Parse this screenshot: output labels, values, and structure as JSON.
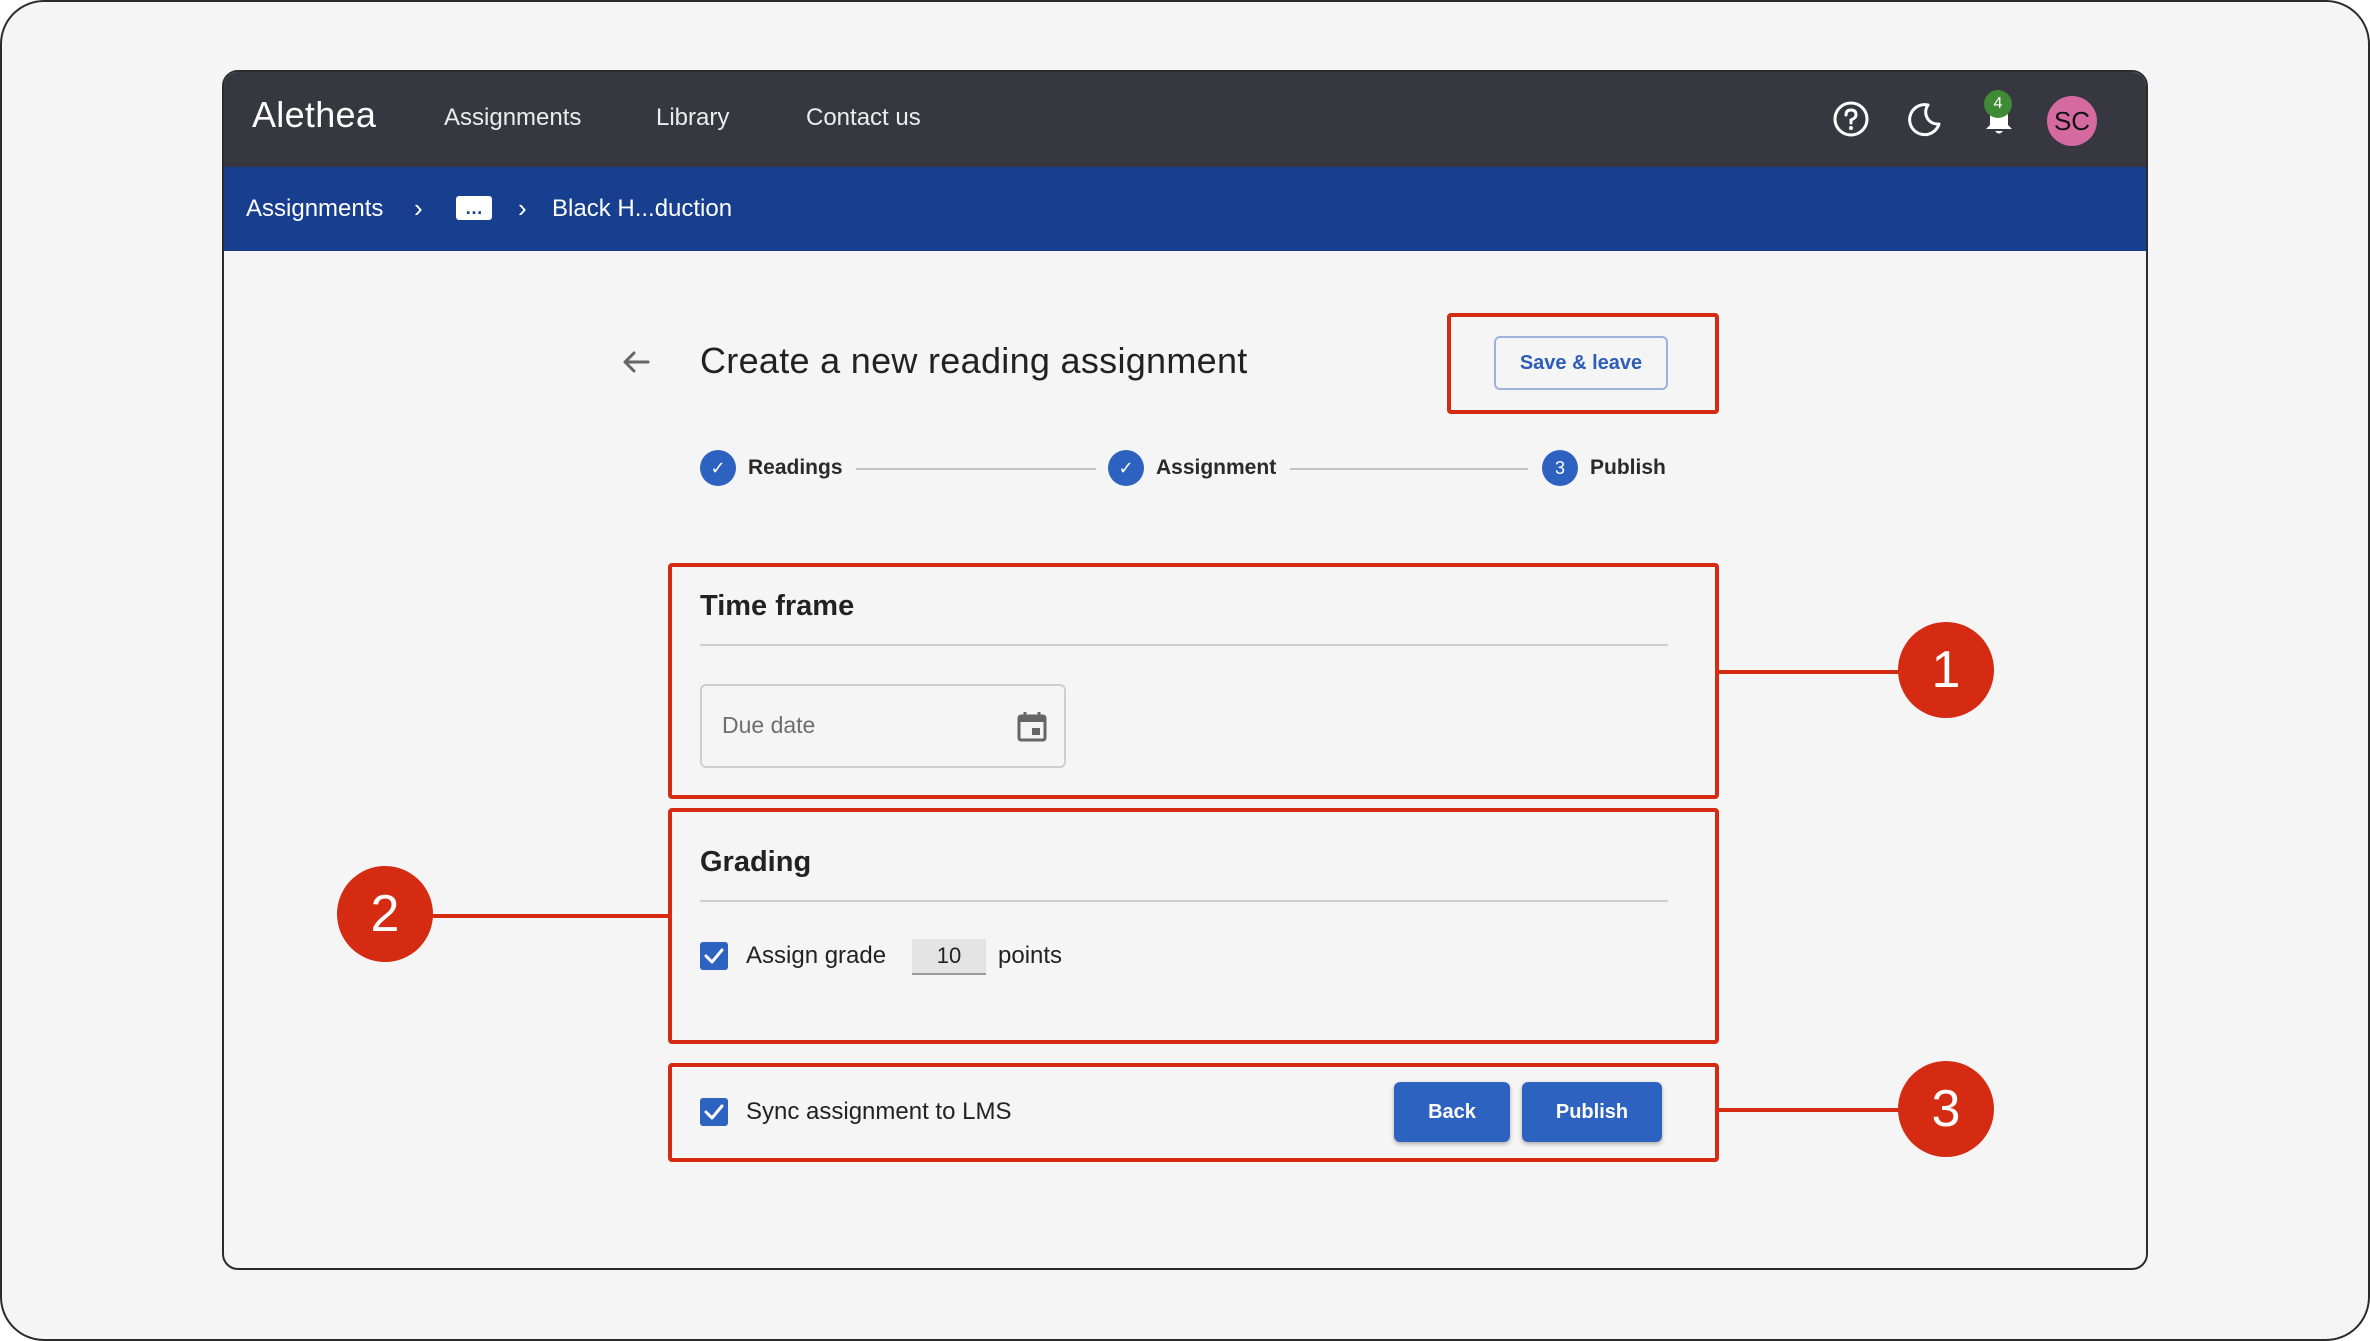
{
  "app": {
    "brand": "Alethea",
    "nav": [
      "Assignments",
      "Library",
      "Contact us"
    ],
    "notification_count": "4",
    "avatar_initials": "SC",
    "icons": [
      "help-icon",
      "dark-mode-icon",
      "bell-icon"
    ]
  },
  "breadcrumb": {
    "root": "Assignments",
    "more": "…",
    "current": "Black H...duction",
    "separator": "›"
  },
  "page": {
    "back_icon": "arrow-left-icon",
    "title": "Create a new reading assignment",
    "save_label": "Save & leave"
  },
  "stepper": {
    "steps": [
      {
        "label": "Readings",
        "state": "complete",
        "marker": "✓"
      },
      {
        "label": "Assignment",
        "state": "complete",
        "marker": "✓"
      },
      {
        "label": "Publish",
        "state": "current",
        "marker": "3"
      }
    ]
  },
  "time_frame": {
    "title": "Time frame",
    "due_date_placeholder": "Due date",
    "icon": "calendar-icon"
  },
  "grading": {
    "title": "Grading",
    "assign_grade_label": "Assign grade",
    "assign_grade_checked": true,
    "points_value": "10",
    "points_suffix": "points"
  },
  "footer": {
    "sync_label": "Sync assignment to LMS",
    "sync_checked": true,
    "back_label": "Back",
    "publish_label": "Publish"
  },
  "annotations": {
    "callouts": [
      "1",
      "2",
      "3"
    ],
    "color": "#d42b12"
  },
  "colors": {
    "topbar": "#37373f",
    "breadcrumb_bar": "#173e8f",
    "primary": "#2d62c0",
    "badge": "#3f8a35",
    "avatar": "#d56aa1"
  }
}
